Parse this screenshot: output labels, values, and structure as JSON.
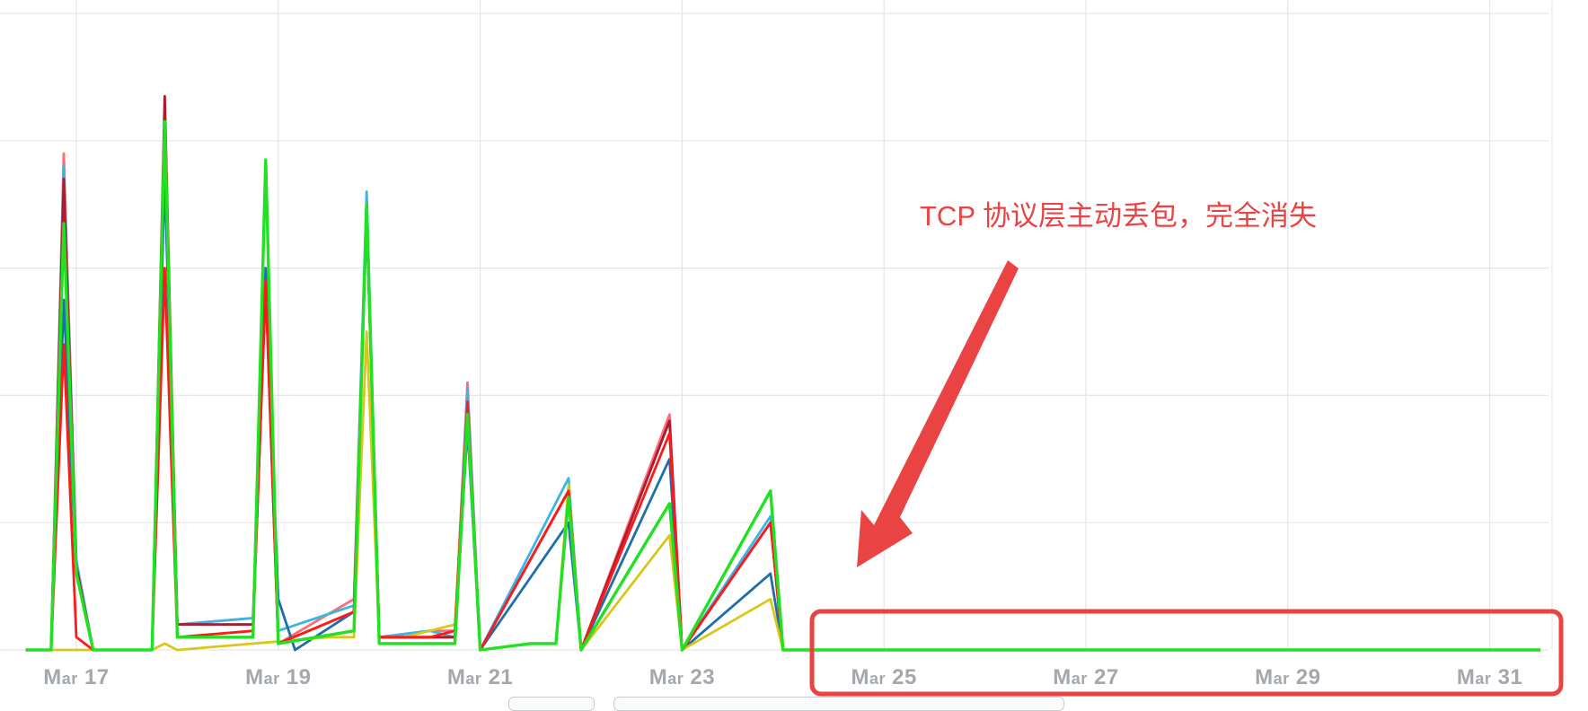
{
  "chart_data": {
    "type": "line",
    "x_ticks": [
      "Mar 17",
      "Mar 19",
      "Mar 21",
      "Mar 23",
      "Mar 25",
      "Mar 27",
      "Mar 29",
      "Mar 31"
    ],
    "x_axis_range": [
      "Mar 16",
      "Mar 31"
    ],
    "y_range": [
      0,
      1
    ],
    "grid": true,
    "legend": "none",
    "series": [
      {
        "color": "#ff6b7a",
        "points": [
          [
            "Mar 16 12:00",
            0
          ],
          [
            "Mar 16 18:00",
            0
          ],
          [
            "Mar 16 21:00",
            0.78
          ],
          [
            "Mar 17 00:00",
            0.14
          ],
          [
            "Mar 17 04:00",
            0
          ],
          [
            "Mar 17 18:00",
            0
          ],
          [
            "Mar 17 21:00",
            0.83
          ],
          [
            "Mar 18 00:00",
            0.04
          ],
          [
            "Mar 18 18:00",
            0.05
          ],
          [
            "Mar 18 21:00",
            0.6
          ],
          [
            "Mar 19 00:00",
            0.01
          ],
          [
            "Mar 19 18:00",
            0.08
          ],
          [
            "Mar 19 21:00",
            0.7
          ],
          [
            "Mar 20 00:00",
            0.02
          ],
          [
            "Mar 20 12:00",
            0.03
          ],
          [
            "Mar 20 18:00",
            0.03
          ],
          [
            "Mar 20 21:00",
            0.42
          ],
          [
            "Mar 21 00:00",
            0
          ],
          [
            "Mar 21 21:00",
            0.25
          ],
          [
            "Mar 22 00:00",
            0
          ],
          [
            "Mar 22 21:00",
            0.37
          ],
          [
            "Mar 23 00:00",
            0
          ],
          [
            "Mar 23 21:00",
            0.25
          ],
          [
            "Mar 24 00:00",
            0
          ],
          [
            "Mar 31 12:00",
            0
          ]
        ]
      },
      {
        "color": "#38b6ea",
        "points": [
          [
            "Mar 16 12:00",
            0
          ],
          [
            "Mar 16 18:00",
            0
          ],
          [
            "Mar 16 21:00",
            0.76
          ],
          [
            "Mar 17 00:00",
            0.14
          ],
          [
            "Mar 17 04:00",
            0
          ],
          [
            "Mar 17 18:00",
            0
          ],
          [
            "Mar 17 21:00",
            0.82
          ],
          [
            "Mar 18 00:00",
            0.04
          ],
          [
            "Mar 18 18:00",
            0.05
          ],
          [
            "Mar 18 21:00",
            0.59
          ],
          [
            "Mar 19 00:00",
            0.03
          ],
          [
            "Mar 19 18:00",
            0.07
          ],
          [
            "Mar 19 21:00",
            0.72
          ],
          [
            "Mar 20 00:00",
            0.02
          ],
          [
            "Mar 20 12:00",
            0.03
          ],
          [
            "Mar 20 18:00",
            0.02
          ],
          [
            "Mar 20 21:00",
            0.41
          ],
          [
            "Mar 21 00:00",
            0
          ],
          [
            "Mar 21 21:00",
            0.27
          ],
          [
            "Mar 22 00:00",
            0
          ],
          [
            "Mar 22 21:00",
            0.36
          ],
          [
            "Mar 23 00:00",
            0
          ],
          [
            "Mar 23 21:00",
            0.21
          ],
          [
            "Mar 24 00:00",
            0
          ],
          [
            "Mar 31 12:00",
            0
          ]
        ]
      },
      {
        "color": "#1e6fa8",
        "points": [
          [
            "Mar 16 12:00",
            0
          ],
          [
            "Mar 16 18:00",
            0
          ],
          [
            "Mar 16 21:00",
            0.55
          ],
          [
            "Mar 17 00:00",
            0.12
          ],
          [
            "Mar 17 04:00",
            0
          ],
          [
            "Mar 17 18:00",
            0
          ],
          [
            "Mar 17 21:00",
            0.75
          ],
          [
            "Mar 18 00:00",
            0.04
          ],
          [
            "Mar 18 18:00",
            0.04
          ],
          [
            "Mar 18 21:00",
            0.6
          ],
          [
            "Mar 19 00:00",
            0.08
          ],
          [
            "Mar 19 04:00",
            0
          ],
          [
            "Mar 19 18:00",
            0.06
          ],
          [
            "Mar 19 21:00",
            0.68
          ],
          [
            "Mar 20 00:00",
            0.02
          ],
          [
            "Mar 20 18:00",
            0.02
          ],
          [
            "Mar 20 21:00",
            0.35
          ],
          [
            "Mar 21 00:00",
            0
          ],
          [
            "Mar 21 21:00",
            0.2
          ],
          [
            "Mar 22 00:00",
            0
          ],
          [
            "Mar 22 21:00",
            0.3
          ],
          [
            "Mar 23 00:00",
            0
          ],
          [
            "Mar 23 21:00",
            0.12
          ],
          [
            "Mar 24 00:00",
            0
          ],
          [
            "Mar 31 12:00",
            0
          ]
        ]
      },
      {
        "color": "#d8c71a",
        "points": [
          [
            "Mar 16 12:00",
            0
          ],
          [
            "Mar 17 18:00",
            0
          ],
          [
            "Mar 17 21:00",
            0.01
          ],
          [
            "Mar 18 00:00",
            0
          ],
          [
            "Mar 19 12:00",
            0.02
          ],
          [
            "Mar 19 18:00",
            0.02
          ],
          [
            "Mar 19 21:00",
            0.5
          ],
          [
            "Mar 20 00:00",
            0.02
          ],
          [
            "Mar 20 06:00",
            0.02
          ],
          [
            "Mar 20 12:00",
            0.03
          ],
          [
            "Mar 20 18:00",
            0.04
          ],
          [
            "Mar 20 21:00",
            0.38
          ],
          [
            "Mar 21 00:00",
            0
          ],
          [
            "Mar 21 12:00",
            0.01
          ],
          [
            "Mar 21 18:00",
            0.01
          ],
          [
            "Mar 21 21:00",
            0.26
          ],
          [
            "Mar 22 00:00",
            0
          ],
          [
            "Mar 22 21:00",
            0.18
          ],
          [
            "Mar 23 00:00",
            0
          ],
          [
            "Mar 23 21:00",
            0.08
          ],
          [
            "Mar 24 00:00",
            0
          ],
          [
            "Mar 31 12:00",
            0
          ]
        ]
      },
      {
        "color": "#b11a2a",
        "points": [
          [
            "Mar 16 12:00",
            0
          ],
          [
            "Mar 16 18:00",
            0
          ],
          [
            "Mar 16 21:00",
            0.74
          ],
          [
            "Mar 17 00:00",
            0.13
          ],
          [
            "Mar 17 04:00",
            0
          ],
          [
            "Mar 17 18:00",
            0
          ],
          [
            "Mar 17 21:00",
            0.87
          ],
          [
            "Mar 18 00:00",
            0.04
          ],
          [
            "Mar 18 18:00",
            0.04
          ],
          [
            "Mar 18 21:00",
            0.57
          ],
          [
            "Mar 19 00:00",
            0.01
          ],
          [
            "Mar 19 18:00",
            0.06
          ],
          [
            "Mar 19 21:00",
            0.69
          ],
          [
            "Mar 20 00:00",
            0.02
          ],
          [
            "Mar 20 12:00",
            0.02
          ],
          [
            "Mar 20 18:00",
            0.02
          ],
          [
            "Mar 20 21:00",
            0.37
          ],
          [
            "Mar 21 00:00",
            0
          ],
          [
            "Mar 21 21:00",
            0.25
          ],
          [
            "Mar 22 00:00",
            0
          ],
          [
            "Mar 22 21:00",
            0.36
          ],
          [
            "Mar 23 00:00",
            0
          ],
          [
            "Mar 23 21:00",
            0.2
          ],
          [
            "Mar 24 00:00",
            0
          ],
          [
            "Mar 31 12:00",
            0
          ]
        ]
      },
      {
        "color": "#ff1a1a",
        "points": [
          [
            "Mar 16 12:00",
            0
          ],
          [
            "Mar 16 18:00",
            0
          ],
          [
            "Mar 16 21:00",
            0.48
          ],
          [
            "Mar 17 00:00",
            0.02
          ],
          [
            "Mar 17 04:00",
            0
          ],
          [
            "Mar 17 18:00",
            0
          ],
          [
            "Mar 17 21:00",
            0.6
          ],
          [
            "Mar 18 00:00",
            0.02
          ],
          [
            "Mar 18 18:00",
            0.03
          ],
          [
            "Mar 18 21:00",
            0.58
          ],
          [
            "Mar 19 00:00",
            0.01
          ],
          [
            "Mar 19 18:00",
            0.06
          ],
          [
            "Mar 19 21:00",
            0.69
          ],
          [
            "Mar 20 00:00",
            0.02
          ],
          [
            "Mar 20 12:00",
            0.02
          ],
          [
            "Mar 20 18:00",
            0.03
          ],
          [
            "Mar 20 21:00",
            0.39
          ],
          [
            "Mar 21 00:00",
            0
          ],
          [
            "Mar 21 21:00",
            0.25
          ],
          [
            "Mar 22 00:00",
            0
          ],
          [
            "Mar 22 21:00",
            0.34
          ],
          [
            "Mar 23 00:00",
            0
          ],
          [
            "Mar 23 21:00",
            0.2
          ],
          [
            "Mar 24 00:00",
            0
          ],
          [
            "Mar 31 12:00",
            0
          ]
        ]
      },
      {
        "color": "#22e022",
        "points": [
          [
            "Mar 16 12:00",
            0
          ],
          [
            "Mar 16 18:00",
            0
          ],
          [
            "Mar 16 21:00",
            0.67
          ],
          [
            "Mar 17 00:00",
            0.12
          ],
          [
            "Mar 17 04:00",
            0
          ],
          [
            "Mar 17 18:00",
            0
          ],
          [
            "Mar 17 21:00",
            0.83
          ],
          [
            "Mar 18 00:00",
            0.02
          ],
          [
            "Mar 18 18:00",
            0.02
          ],
          [
            "Mar 18 21:00",
            0.77
          ],
          [
            "Mar 19 00:00",
            0.01
          ],
          [
            "Mar 19 18:00",
            0.03
          ],
          [
            "Mar 19 21:00",
            0.7
          ],
          [
            "Mar 20 00:00",
            0.01
          ],
          [
            "Mar 20 12:00",
            0.01
          ],
          [
            "Mar 20 18:00",
            0.01
          ],
          [
            "Mar 20 21:00",
            0.37
          ],
          [
            "Mar 21 00:00",
            0
          ],
          [
            "Mar 21 12:00",
            0.01
          ],
          [
            "Mar 21 18:00",
            0.01
          ],
          [
            "Mar 21 21:00",
            0.24
          ],
          [
            "Mar 22 00:00",
            0
          ],
          [
            "Mar 22 21:00",
            0.23
          ],
          [
            "Mar 23 00:00",
            0
          ],
          [
            "Mar 23 21:00",
            0.25
          ],
          [
            "Mar 24 00:00",
            0
          ],
          [
            "Mar 31 12:00",
            0
          ]
        ]
      }
    ]
  },
  "annotation": {
    "text": "TCP 协议层主动丢包，完全消失",
    "color": "#ea4343"
  },
  "colors": {
    "grid": "#e3e5e8",
    "tick_label": "#a3a8ae",
    "annotation_box": "#ea4343"
  }
}
